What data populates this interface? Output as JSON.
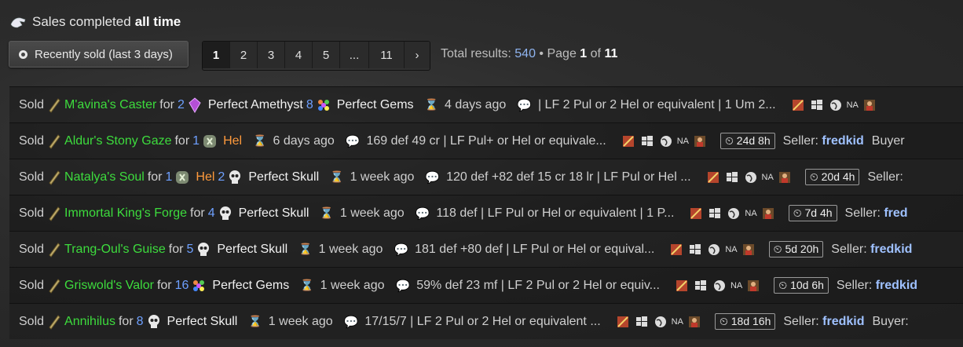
{
  "header": {
    "prefix": "Sales completed",
    "bold": "all time"
  },
  "recent_button": {
    "label": "Recently sold (last 3 days)"
  },
  "pagination": {
    "pages": [
      "1",
      "2",
      "3",
      "4",
      "5",
      "...",
      "11",
      "›"
    ],
    "active": "1"
  },
  "totals": {
    "label": "Total results:",
    "count": "540",
    "page_prefix": "• Page",
    "page": "1",
    "of_label": "of",
    "pages": "11"
  },
  "listings": [
    {
      "sold": "Sold",
      "item": "M'avina's Caster",
      "for": "for",
      "price": [
        {
          "qty": "2",
          "icon": "amethyst-icon"
        },
        {
          "name": "Perfect Amethyst",
          "qty": "8",
          "icon": "gems-icon"
        },
        {
          "name": "Perfect Gems"
        }
      ],
      "age": "4 days ago",
      "desc": "| LF 2 Pul or 2 Hel or equivalent | 1 Um 2...",
      "region": "NA",
      "timer": "",
      "seller_label": "",
      "seller": "",
      "tail": ""
    },
    {
      "sold": "Sold",
      "item": "Aldur's Stony Gaze",
      "for": "for",
      "price": [
        {
          "qty": "1",
          "icon": "rune-icon"
        },
        {
          "name": "Hel",
          "rune": true
        }
      ],
      "age": "6 days ago",
      "desc": "169 def 49 cr | LF Pul+ or Hel or equivale...",
      "region": "NA",
      "timer": "24d 8h",
      "seller_label": "Seller:",
      "seller": "fredkid",
      "tail": "Buyer"
    },
    {
      "sold": "Sold",
      "item": "Natalya's Soul",
      "for": "for",
      "price": [
        {
          "qty": "1",
          "icon": "rune-icon"
        },
        {
          "name": "Hel",
          "rune": true,
          "qty": "2",
          "icon": "skull-icon"
        },
        {
          "name": "Perfect Skull"
        }
      ],
      "age": "1 week ago",
      "desc": "120 def +82 def 15 cr 18 lr | LF Pul or Hel ...",
      "region": "NA",
      "timer": "20d 4h",
      "seller_label": "Seller:",
      "seller": "",
      "tail": ""
    },
    {
      "sold": "Sold",
      "item": "Immortal King's Forge",
      "for": "for",
      "price": [
        {
          "qty": "4",
          "icon": "skull-icon"
        },
        {
          "name": "Perfect Skull"
        }
      ],
      "age": "1 week ago",
      "desc": "118 def | LF Pul or Hel or equivalent | 1 P...",
      "region": "NA",
      "timer": "7d 4h",
      "seller_label": "Seller:",
      "seller": "fred",
      "tail": ""
    },
    {
      "sold": "Sold",
      "item": "Trang-Oul's Guise",
      "for": "for",
      "price": [
        {
          "qty": "5",
          "icon": "skull-icon"
        },
        {
          "name": "Perfect Skull"
        }
      ],
      "age": "1 week ago",
      "desc": "181 def +80 def | LF Pul or Hel or equival...",
      "region": "NA",
      "timer": "5d 20h",
      "seller_label": "Seller:",
      "seller": "fredkid",
      "tail": ""
    },
    {
      "sold": "Sold",
      "item": "Griswold's Valor",
      "for": "for",
      "price": [
        {
          "qty": "16",
          "icon": "gems-icon"
        },
        {
          "name": "Perfect Gems"
        }
      ],
      "age": "1 week ago",
      "desc": "59% def 23 mf | LF 2 Pul or 2 Hel or equiv...",
      "region": "NA",
      "timer": "10d 6h",
      "seller_label": "Seller:",
      "seller": "fredkid",
      "tail": ""
    },
    {
      "sold": "Sold",
      "item": "Annihilus",
      "for": "for",
      "price": [
        {
          "qty": "8",
          "icon": "skull-icon"
        },
        {
          "name": "Perfect Skull"
        }
      ],
      "age": "1 week ago",
      "desc": "17/15/7 | LF 2 Pul or 2 Hel or equivalent ...",
      "region": "NA",
      "timer": "18d 16h",
      "seller_label": "Seller:",
      "seller": "fredkid",
      "tail": "Buyer:"
    }
  ],
  "colors": {
    "item_name": "#3ddc3d",
    "qty": "#6ea0ff",
    "rune": "#ff9a3c",
    "seller": "#9fc1ff"
  }
}
